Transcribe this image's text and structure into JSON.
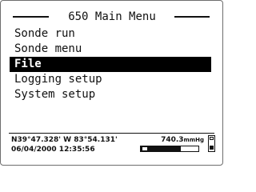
{
  "screen": {
    "title": "650 Main Menu",
    "menu_items": [
      {
        "label": "Sonde run",
        "selected": false
      },
      {
        "label": "Sonde menu",
        "selected": false
      },
      {
        "label": "File",
        "selected": true
      },
      {
        "label": "Logging setup",
        "selected": false
      },
      {
        "label": "System setup",
        "selected": false
      }
    ]
  },
  "status": {
    "coordinates": "N39°47.328' W 83°54.131'",
    "pressure_value": "740.3",
    "pressure_unit": "mmHg",
    "datetime": "06/04/2000 12:35:56",
    "battery_level": 0.7
  },
  "icons": {
    "battery": "battery-icon",
    "memory_card": "memory-card-icon"
  },
  "colors": {
    "foreground": "#111111",
    "selection_background": "#000000",
    "selection_text": "#ffffff"
  }
}
